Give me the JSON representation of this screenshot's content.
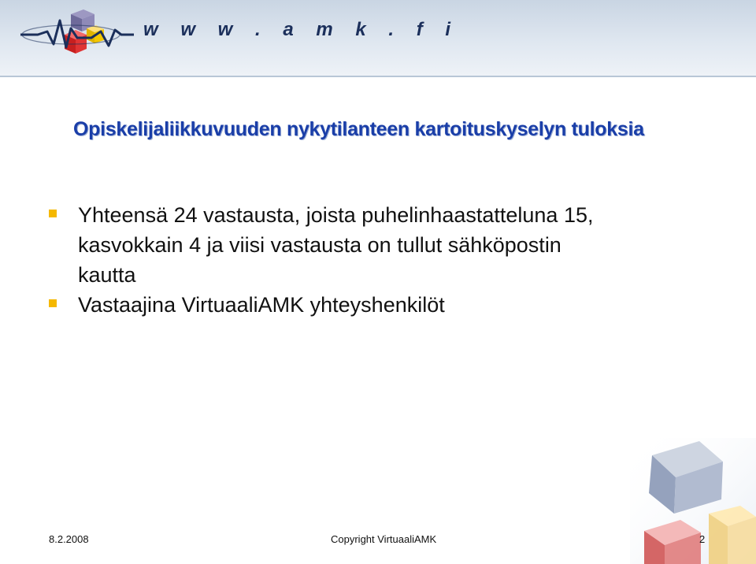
{
  "header": {
    "url_text": "w w w . a m k . f i",
    "logo_icon": "amk-wave-cube-logo"
  },
  "slide": {
    "title": "Opiskelijaliikkuvuuden nykytilanteen kartoituskyselyn tuloksia",
    "bullets": [
      {
        "lines": [
          "Yhteensä 24 vastausta, joista puhelinhaastatteluna 15,",
          "kasvokkain 4 ja viisi vastausta on tullut sähköpostin",
          "kautta"
        ]
      },
      {
        "lines": [
          "Vastaajina VirtuaaliAMK yhteyshenkilöt"
        ]
      }
    ]
  },
  "footer": {
    "date": "8.2.2008",
    "copyright": "Copyright VirtuaaliAMK",
    "page_number": "2"
  },
  "colors": {
    "title": "#1a3ea8",
    "bullet": "#f5b800",
    "header_bg": "#dfe7f0",
    "url_text": "#1b2f5b"
  }
}
